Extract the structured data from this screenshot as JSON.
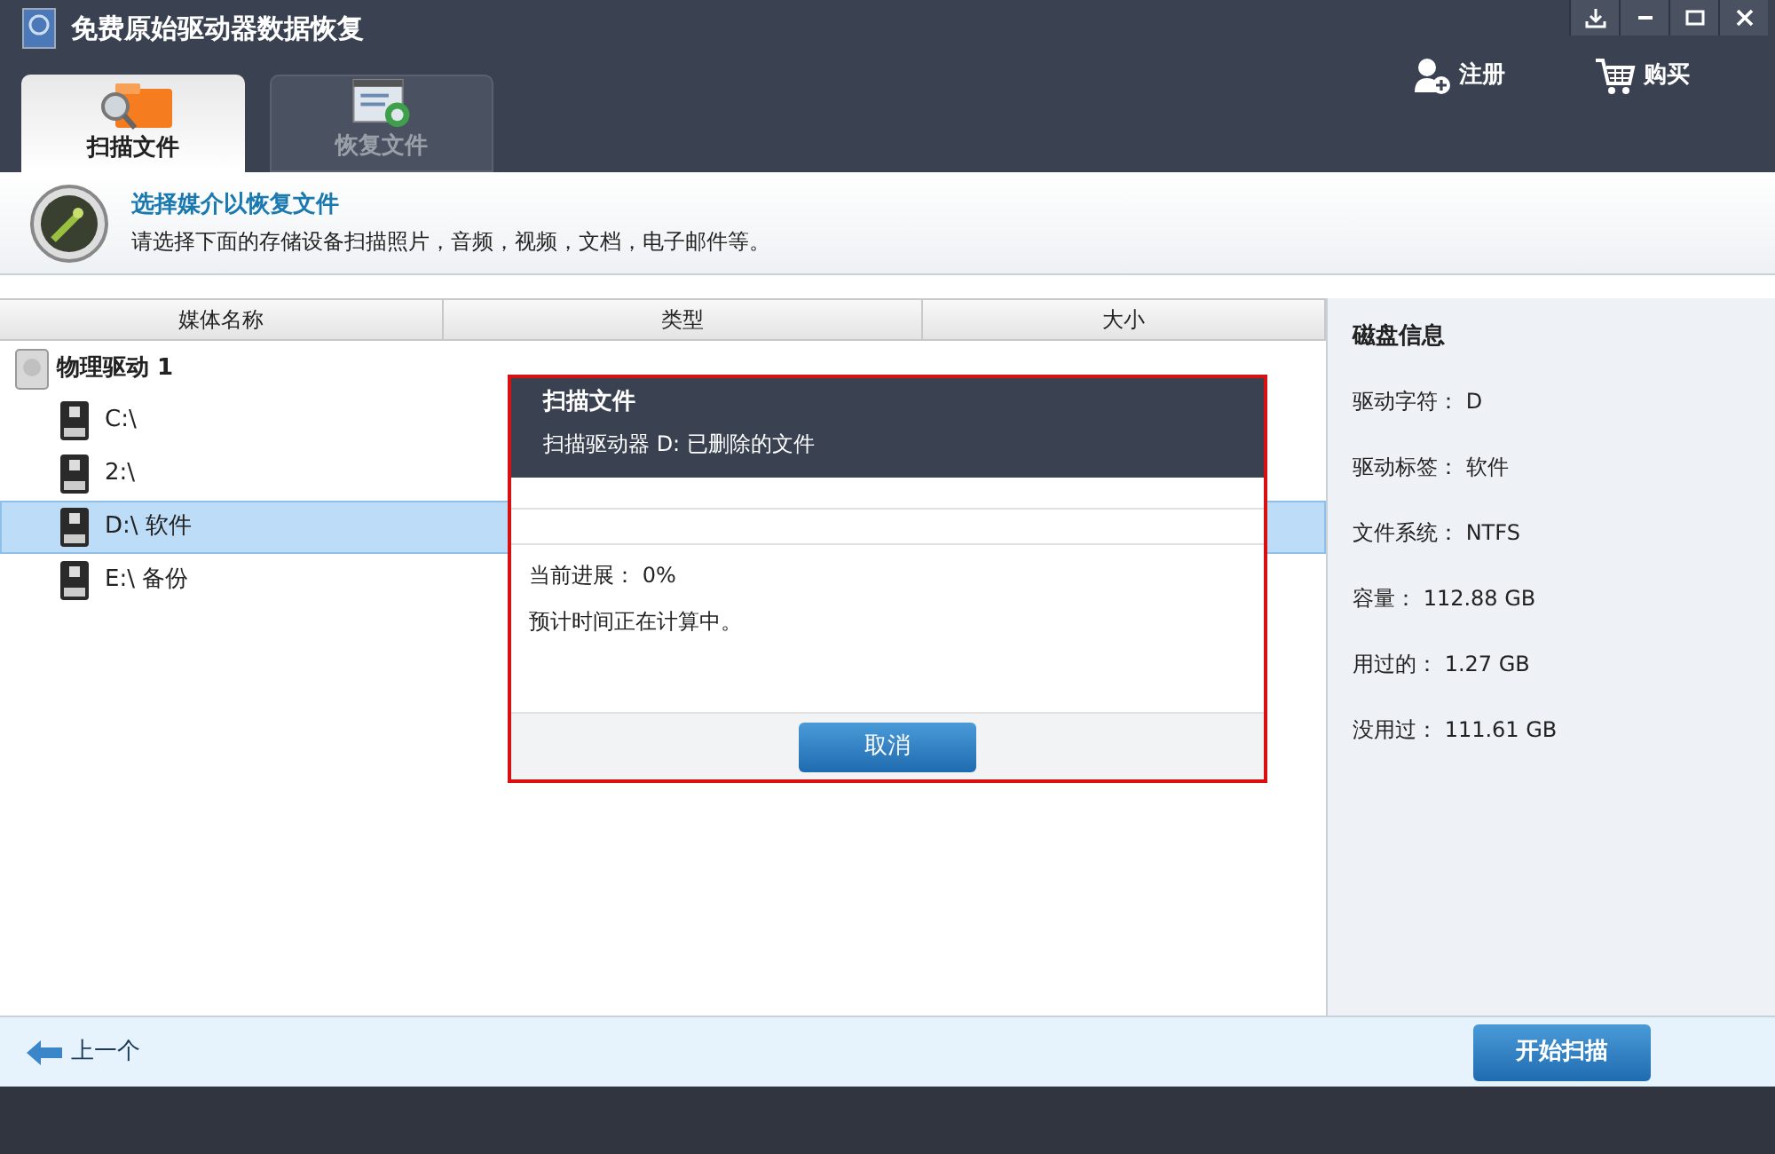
{
  "window": {
    "title": "免费原始驱动器数据恢复"
  },
  "header_actions": [
    {
      "kind": "register",
      "label": "注册"
    },
    {
      "kind": "buy",
      "label": "购买"
    }
  ],
  "tabs": [
    {
      "kind": "scan",
      "label": "扫描文件",
      "selected": true
    },
    {
      "kind": "recover",
      "label": "恢复文件",
      "selected": false
    }
  ],
  "intro": {
    "title": "选择媒介以恢复文件",
    "text": "请选择下面的存储设备扫描照片，音频，视频，文档，电子邮件等。"
  },
  "table": {
    "columns": [
      "媒体名称",
      "类型",
      "大小"
    ],
    "tree": [
      {
        "label": "物理驱动 1",
        "children": [
          {
            "label": "C:\\",
            "selected": false
          },
          {
            "label": "2:\\",
            "selected": false
          },
          {
            "label": "D:\\ 软件",
            "selected": true
          },
          {
            "label": "E:\\ 备份",
            "selected": false
          }
        ]
      }
    ]
  },
  "disk_info": {
    "title": "磁盘信息",
    "rows": [
      {
        "label": "驱动字符：",
        "value": "D"
      },
      {
        "label": "驱动标签：",
        "value": "软件"
      },
      {
        "label": "文件系统：",
        "value": "NTFS"
      },
      {
        "label": "容量：",
        "value": "112.88 GB"
      },
      {
        "label": "用过的：",
        "value": "1.27 GB"
      },
      {
        "label": "没用过：",
        "value": "111.61 GB"
      }
    ]
  },
  "dialog": {
    "title": "扫描文件",
    "subtitle": "扫描驱动器 D: 已删除的文件",
    "progress": {
      "level": 0
    },
    "progress_label": "当前进展：",
    "progress_value": "0%",
    "eta": "预计时间正在计算中。",
    "cancel": "取消"
  },
  "footer": {
    "back": "上一个",
    "start": "开始扫描"
  }
}
